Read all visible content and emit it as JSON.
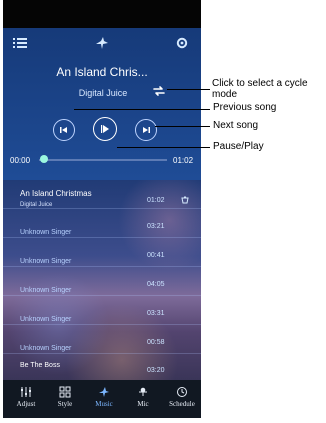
{
  "topbar": {
    "icons": [
      "menu-icon",
      "logo-icon",
      "gear-icon"
    ]
  },
  "player": {
    "title": "An Island Chris...",
    "artist": "Digital Juice",
    "current_time": "00:00",
    "total_time": "01:02",
    "progress": 0
  },
  "controls": {
    "cycle_icon": "cycle-icon",
    "prev_icon": "previous-icon",
    "play_icon": "play-pause-icon",
    "next_icon": "next-icon"
  },
  "playlist": {
    "rows": [
      {
        "title": "An Island Christmas",
        "artist": "Digital Juice",
        "time": "01:02",
        "current": true
      },
      {
        "title": "Unknown Singer",
        "artist": "",
        "time": "03:21",
        "current": false
      },
      {
        "title": "Unknown Singer",
        "artist": "",
        "time": "00:41",
        "current": false
      },
      {
        "title": "Unknown Singer",
        "artist": "",
        "time": "04:05",
        "current": false
      },
      {
        "title": "Unknown Singer",
        "artist": "",
        "time": "03:31",
        "current": false
      },
      {
        "title": "Unknown Singer",
        "artist": "",
        "time": "00:58",
        "current": false
      },
      {
        "title": "Be The Boss",
        "artist": "",
        "time": "03:20",
        "current": false
      }
    ]
  },
  "tabs": [
    {
      "label": "Adjust",
      "icon": "adjust-icon"
    },
    {
      "label": "Style",
      "icon": "style-icon"
    },
    {
      "label": "Music",
      "icon": "music-icon",
      "active": true
    },
    {
      "label": "Mic",
      "icon": "mic-icon"
    },
    {
      "label": "Schedule",
      "icon": "schedule-icon"
    }
  ],
  "annotations": {
    "cycle_line1": "Click to select a cycle",
    "cycle_line2": "mode",
    "previous": "Previous song",
    "next": "Next song",
    "pause_play": "Pause/Play"
  },
  "colors": {
    "panel": "#1f4c96",
    "accent": "#9af7df",
    "tab_active": "#7cb6ff"
  }
}
